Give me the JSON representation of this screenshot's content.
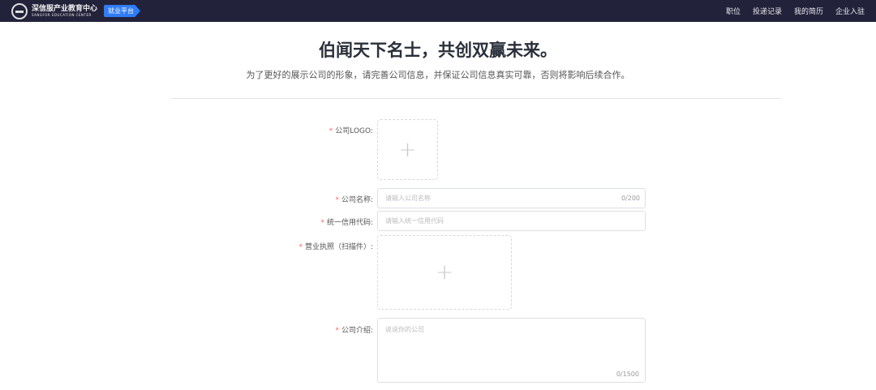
{
  "header": {
    "brand_cn": "深信服产业教育中心",
    "brand_en": "SANGFOR EDUCATION CENTER",
    "badge": "就业平台",
    "nav": [
      "职位",
      "投递记录",
      "我的简历",
      "企业入驻"
    ]
  },
  "title": "伯闻天下名士，共创双赢未来。",
  "subtitle": "为了更好的展示公司的形象，请完善公司信息，并保证公司信息真实可靠，否则将影响后续合作。",
  "form": {
    "required_mark": "*",
    "logo_label": "公司LOGO:",
    "name_label": "公司名称:",
    "name_placeholder": "请输入公司名称",
    "name_count": "0/200",
    "code_label": "统一信用代码:",
    "code_placeholder": "请输入统一信用代码",
    "license_label": "营业执照（扫描件）:",
    "intro_label": "公司介绍:",
    "intro_placeholder": "说说你的公司",
    "intro_count": "0/1500",
    "plus": "+"
  }
}
